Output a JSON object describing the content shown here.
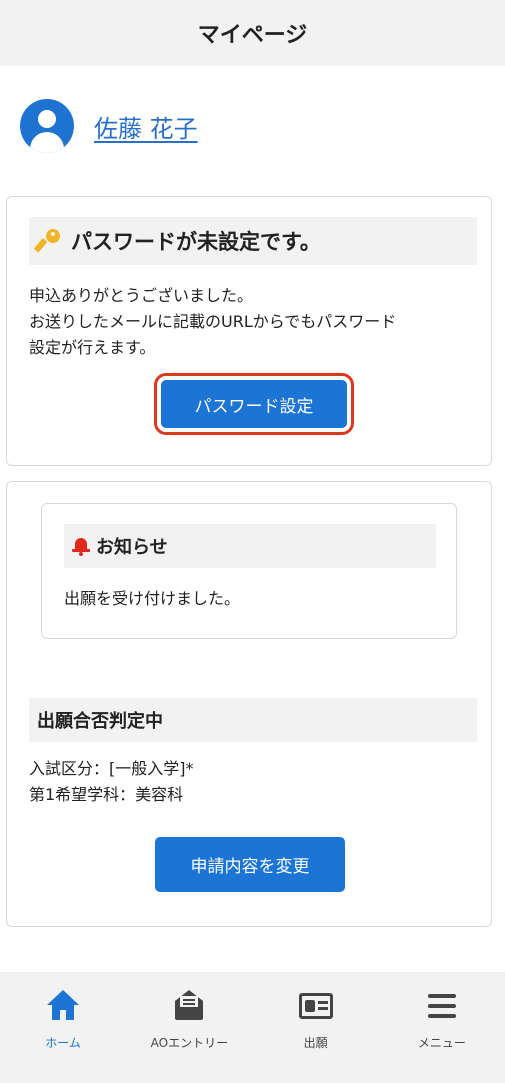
{
  "header": {
    "title": "マイページ"
  },
  "user": {
    "name": "佐藤 花子"
  },
  "password_card": {
    "heading": "パスワードが未設定です。",
    "lines": [
      "申込ありがとうございました。",
      "お送りしたメールに記載のURLからでもパスワード",
      "設定が行えます。"
    ],
    "button_label": "パスワード設定"
  },
  "notice": {
    "heading": "お知らせ",
    "text": "出願を受け付けました。"
  },
  "status": {
    "heading": "出願合否判定中",
    "lines": [
      "入試区分：[一般入学]*",
      "第1希望学科：美容科"
    ],
    "button_label": "申請内容を変更"
  },
  "bottom_nav": {
    "items": [
      {
        "label": "ホーム",
        "icon": "home-icon",
        "active": true
      },
      {
        "label": "AOエントリー",
        "icon": "envelope-open-icon",
        "active": false
      },
      {
        "label": "出願",
        "icon": "id-card-icon",
        "active": false
      },
      {
        "label": "メニュー",
        "icon": "menu-icon",
        "active": false
      }
    ]
  },
  "colors": {
    "primary": "#1c74d4",
    "link": "#2a6fc9",
    "highlight_border": "#d8391f",
    "key": "#f0b428",
    "bell": "#e0281e",
    "header_bg": "#f2f2f2"
  }
}
